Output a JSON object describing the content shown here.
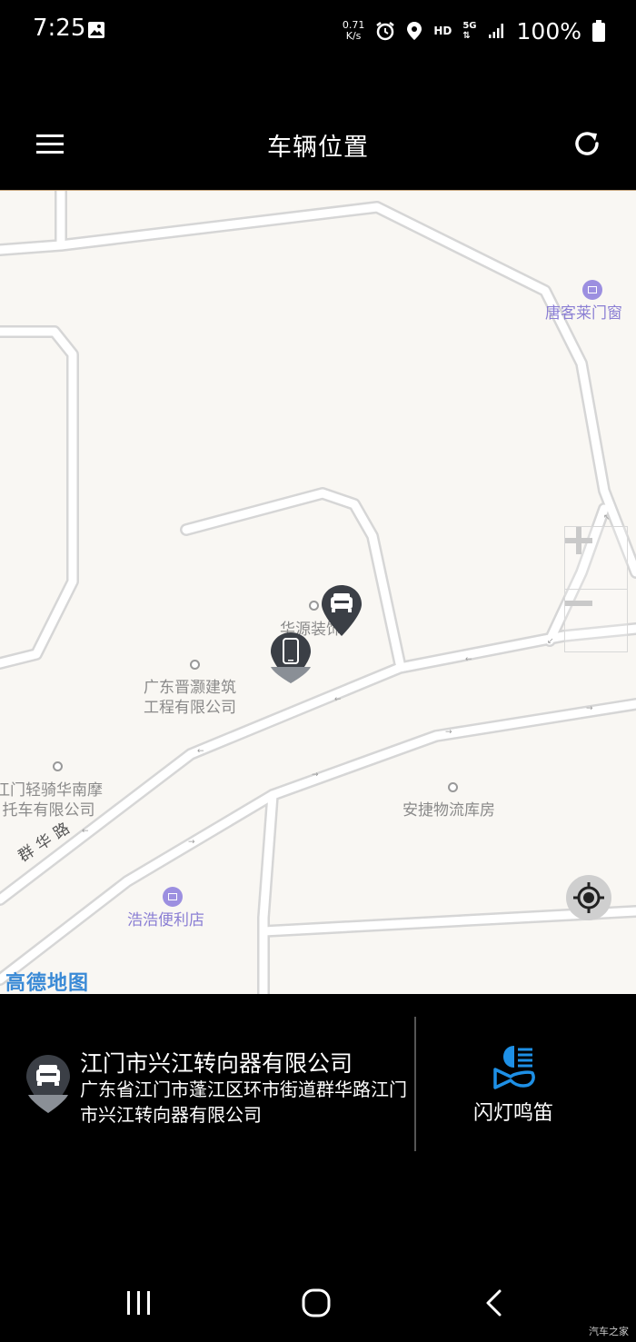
{
  "status_bar": {
    "time": "7:25",
    "net_speed_value": "0.71",
    "net_speed_unit": "K/s",
    "hd": "HD",
    "network": "5G",
    "battery": "100%"
  },
  "header": {
    "title": "车辆位置"
  },
  "map": {
    "pois": [
      {
        "label": "唐客莱门窗"
      },
      {
        "label": "华源装饰"
      },
      {
        "label": "广东晋灏建筑\n工程有限公司"
      },
      {
        "label": "江门轻骑华南摩\n托车有限公司"
      },
      {
        "label": "安捷物流库房"
      },
      {
        "label": "浩浩便利店"
      }
    ],
    "road_label": "群华路",
    "logo": "高德地图",
    "controls": {
      "zoom_in": "+",
      "zoom_out": "−"
    },
    "markers": {
      "car": "car-marker",
      "phone": "phone-marker"
    }
  },
  "vehicle": {
    "name": "江门市兴江转向器有限公司",
    "address": "广东省江门市蓬江区环市街道群华路江门市兴江转向器有限公司"
  },
  "actions": {
    "flash_horn_label": "闪灯鸣笛"
  },
  "colors": {
    "accent_blue": "#1e90e6",
    "map_bg": "#f9f7f3",
    "poi_purple": "#8b7fd4",
    "marker_dark": "#3b3f46",
    "marker_grey": "#8a8f96"
  },
  "watermark": "汽车之家"
}
